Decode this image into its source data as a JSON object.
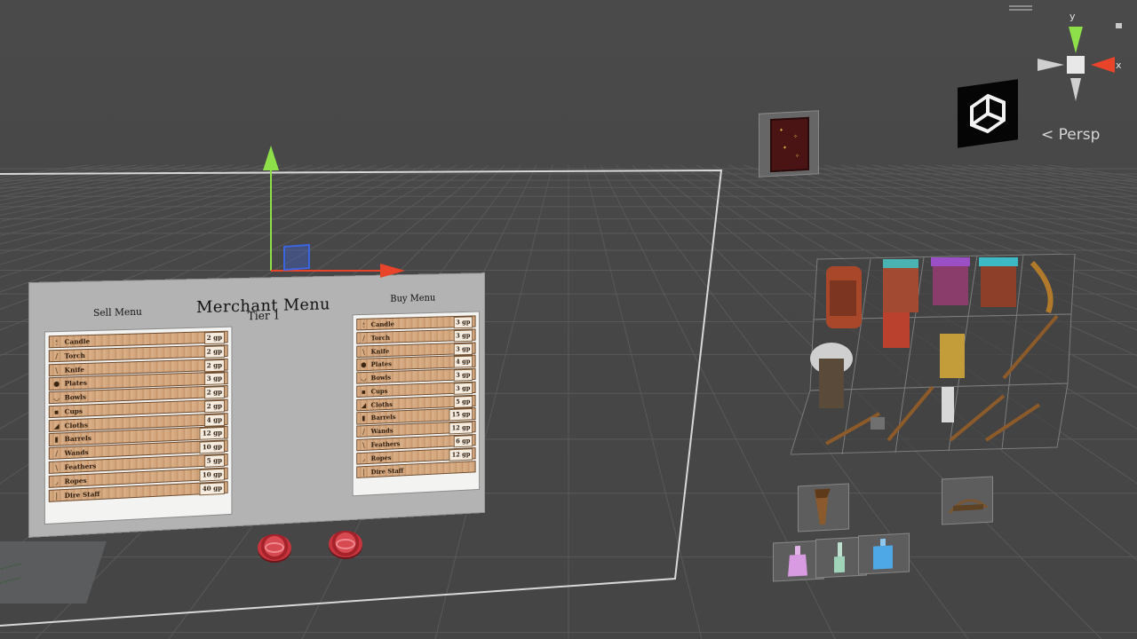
{
  "viewport": {
    "projection_label": "Persp",
    "axes": {
      "x": "x",
      "y": "y"
    }
  },
  "merchant": {
    "title": "Merchant Menu",
    "subtitle": "Tier 1",
    "sell_label": "Sell Menu",
    "buy_label": "Buy Menu",
    "sell_items": [
      {
        "icon": "candle-icon",
        "glyph": "🕯",
        "name": "Candle",
        "price": "2 gp"
      },
      {
        "icon": "torch-icon",
        "glyph": "/",
        "name": "Torch",
        "price": "2 gp"
      },
      {
        "icon": "knife-icon",
        "glyph": "\\",
        "name": "Knife",
        "price": "2 gp"
      },
      {
        "icon": "plate-icon",
        "glyph": "●",
        "name": "Plates",
        "price": "3 gp"
      },
      {
        "icon": "bowl-icon",
        "glyph": "◡",
        "name": "Bowls",
        "price": "2 gp"
      },
      {
        "icon": "cup-icon",
        "glyph": "▪",
        "name": "Cups",
        "price": "2 gp"
      },
      {
        "icon": "cloth-icon",
        "glyph": "◢",
        "name": "Cloths",
        "price": "4 gp"
      },
      {
        "icon": "barrel-icon",
        "glyph": "▮",
        "name": "Barrels",
        "price": "12 gp"
      },
      {
        "icon": "wand-icon",
        "glyph": "/",
        "name": "Wands",
        "price": "10 gp"
      },
      {
        "icon": "feather-icon",
        "glyph": "\\",
        "name": "Feathers",
        "price": "5 gp"
      },
      {
        "icon": "rope-icon",
        "glyph": "◞",
        "name": "Ropes",
        "price": "10 gp"
      },
      {
        "icon": "staff-icon",
        "glyph": "|",
        "name": "Dire Staff",
        "price": "40 gp"
      }
    ],
    "buy_items": [
      {
        "icon": "candle-icon",
        "glyph": "🕯",
        "name": "Candle",
        "price": "3 gp"
      },
      {
        "icon": "torch-icon",
        "glyph": "/",
        "name": "Torch",
        "price": "3 gp"
      },
      {
        "icon": "knife-icon",
        "glyph": "\\",
        "name": "Knife",
        "price": "3 gp"
      },
      {
        "icon": "plate-icon",
        "glyph": "●",
        "name": "Plates",
        "price": "4 gp"
      },
      {
        "icon": "bowl-icon",
        "glyph": "◡",
        "name": "Bowls",
        "price": "3 gp"
      },
      {
        "icon": "cup-icon",
        "glyph": "▪",
        "name": "Cups",
        "price": "3 gp"
      },
      {
        "icon": "cloth-icon",
        "glyph": "◢",
        "name": "Cloths",
        "price": "5 gp"
      },
      {
        "icon": "barrel-icon",
        "glyph": "▮",
        "name": "Barrels",
        "price": "15 gp"
      },
      {
        "icon": "wand-icon",
        "glyph": "/",
        "name": "Wands",
        "price": "12 gp"
      },
      {
        "icon": "feather-icon",
        "glyph": "\\",
        "name": "Feathers",
        "price": "6 gp"
      },
      {
        "icon": "rope-icon",
        "glyph": "◞",
        "name": "Ropes",
        "price": "12 gp"
      },
      {
        "icon": "staff-icon",
        "glyph": "|",
        "name": "Dire Staff",
        "price": ""
      }
    ]
  },
  "colors": {
    "background": "#474747",
    "grid": "#5a5a5a",
    "axis_x": "#e8442a",
    "axis_y": "#8ee04a",
    "axis_z": "#3b64e0"
  }
}
